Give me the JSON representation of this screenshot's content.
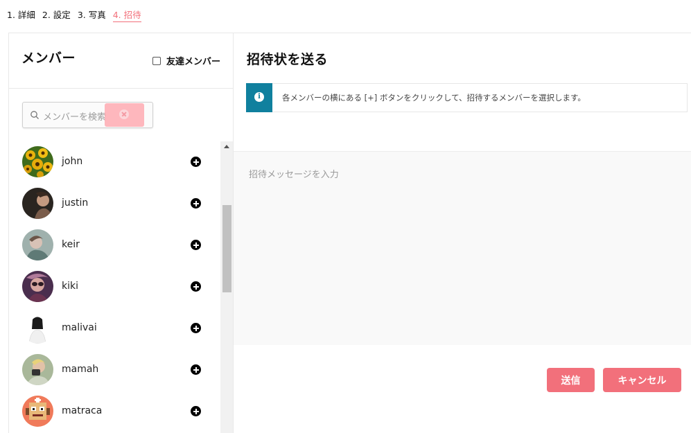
{
  "steps": [
    {
      "label": "1. 詳細",
      "active": false
    },
    {
      "label": "2. 設定",
      "active": false
    },
    {
      "label": "3. 写真",
      "active": false
    },
    {
      "label": "4. 招待",
      "active": true
    }
  ],
  "members_panel": {
    "title": "メンバー",
    "friend_filter_label": "友達メンバー",
    "friend_filter_checked": false,
    "search": {
      "placeholder": "メンバーを検索",
      "value": ""
    }
  },
  "members": [
    {
      "name": "john",
      "avatar_icon": "sunflower-photo"
    },
    {
      "name": "justin",
      "avatar_icon": "person-photo"
    },
    {
      "name": "keir",
      "avatar_icon": "person-photo"
    },
    {
      "name": "kiki",
      "avatar_icon": "person-photo"
    },
    {
      "name": "malivai",
      "avatar_icon": "person-photo"
    },
    {
      "name": "mamah",
      "avatar_icon": "person-photo"
    },
    {
      "name": "matraca",
      "avatar_icon": "pixel-art-avatar"
    }
  ],
  "invite_panel": {
    "title": "招待状を送る",
    "info_text": "各メンバーの横にある [+] ボタンをクリックして、招待するメンバーを選択します。",
    "message_placeholder": "招待メッセージを入力",
    "send_label": "送信",
    "cancel_label": "キャンセル"
  },
  "colors": {
    "accent": "#f2707b",
    "info": "#10809e"
  }
}
